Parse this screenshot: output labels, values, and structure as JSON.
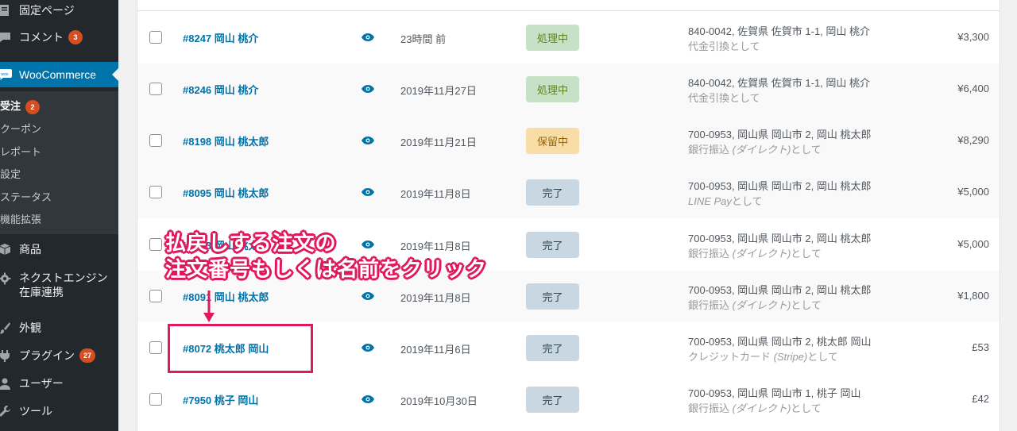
{
  "sidebar": {
    "items": [
      {
        "label": "固定ページ",
        "icon": "page-icon"
      },
      {
        "label": "コメント",
        "badge": "3",
        "icon": "comment-icon"
      },
      {
        "label": "WooCommerce",
        "icon": "woo-icon"
      },
      {
        "label": "商品",
        "icon": "box-icon"
      },
      {
        "label": "ネクストエンジン",
        "label2": "在庫連携",
        "icon": "gear-icon"
      },
      {
        "label": "外観",
        "icon": "brush-icon"
      },
      {
        "label": "プラグイン",
        "badge": "27",
        "icon": "plugin-icon"
      },
      {
        "label": "ユーザー",
        "icon": "user-icon"
      },
      {
        "label": "ツール",
        "icon": "wrench-icon"
      }
    ],
    "submenu": [
      {
        "label": "受注",
        "badge": "2"
      },
      {
        "label": "クーポン"
      },
      {
        "label": "レポート"
      },
      {
        "label": "設定"
      },
      {
        "label": "ステータス"
      },
      {
        "label": "機能拡張"
      }
    ]
  },
  "orders": [
    {
      "id": "#8247 岡山 桃介",
      "date": "23時間 前",
      "status": "処理中",
      "status_type": "processing",
      "address": "840-0042, 佐賀県 佐賀市 1-1, 岡山 桃介",
      "via": "代金引換として",
      "total": "¥3,300"
    },
    {
      "id": "#8246 岡山 桃介",
      "date": "2019年11月27日",
      "status": "処理中",
      "status_type": "processing",
      "address": "840-0042, 佐賀県 佐賀市 1-1, 岡山 桃介",
      "via": "代金引換として",
      "total": "¥6,400"
    },
    {
      "id": "#8198 岡山 桃太郎",
      "date": "2019年11月21日",
      "status": "保留中",
      "status_type": "on-hold",
      "address": "700-0953, 岡山県 岡山市 2, 岡山 桃太郎",
      "via_pre": "銀行振込 ",
      "via_italic": "(ダイレクト)",
      "via_post": "として",
      "total": "¥8,290"
    },
    {
      "id": "#8095 岡山 桃太郎",
      "date": "2019年11月8日",
      "status": "完了",
      "status_type": "completed",
      "address": "700-0953, 岡山県 岡山市 2, 岡山 桃太郎",
      "via_pre": "",
      "via_italic": "LINE Pay",
      "via_post": "として",
      "total": "¥5,000"
    },
    {
      "id": "#8093 岡山 桃太郎",
      "date": "2019年11月8日",
      "status": "完了",
      "status_type": "completed",
      "address": "700-0953, 岡山県 岡山市 2, 岡山 桃太郎",
      "via_pre": "銀行振込 ",
      "via_italic": "(ダイレクト)",
      "via_post": "として",
      "total": "¥5,000"
    },
    {
      "id": "#8091 岡山 桃太郎",
      "date": "2019年11月8日",
      "status": "完了",
      "status_type": "completed",
      "address": "700-0953, 岡山県 岡山市 2, 岡山 桃太郎",
      "via_pre": "銀行振込 ",
      "via_italic": "(ダイレクト)",
      "via_post": "として",
      "total": "¥1,800"
    },
    {
      "id": "#8072 桃太郎 岡山",
      "date": "2019年11月6日",
      "status": "完了",
      "status_type": "completed",
      "address": "700-0953, 岡山県 岡山市 2, 桃太郎 岡山",
      "via_pre": "クレジットカード ",
      "via_italic": "(Stripe)",
      "via_post": "として",
      "total": "£53"
    },
    {
      "id": "#7950 桃子 岡山",
      "date": "2019年10月30日",
      "status": "完了",
      "status_type": "completed",
      "address": "700-0953, 岡山県 岡山市 1, 桃子 岡山",
      "via_pre": "銀行振込 ",
      "via_italic": "(ダイレクト)",
      "via_post": "として",
      "total": "£42"
    }
  ],
  "annotation": {
    "line1": "払戻しする注文の",
    "line2": "注文番号もしくは名前をクリック",
    "color": "#e0185e"
  }
}
